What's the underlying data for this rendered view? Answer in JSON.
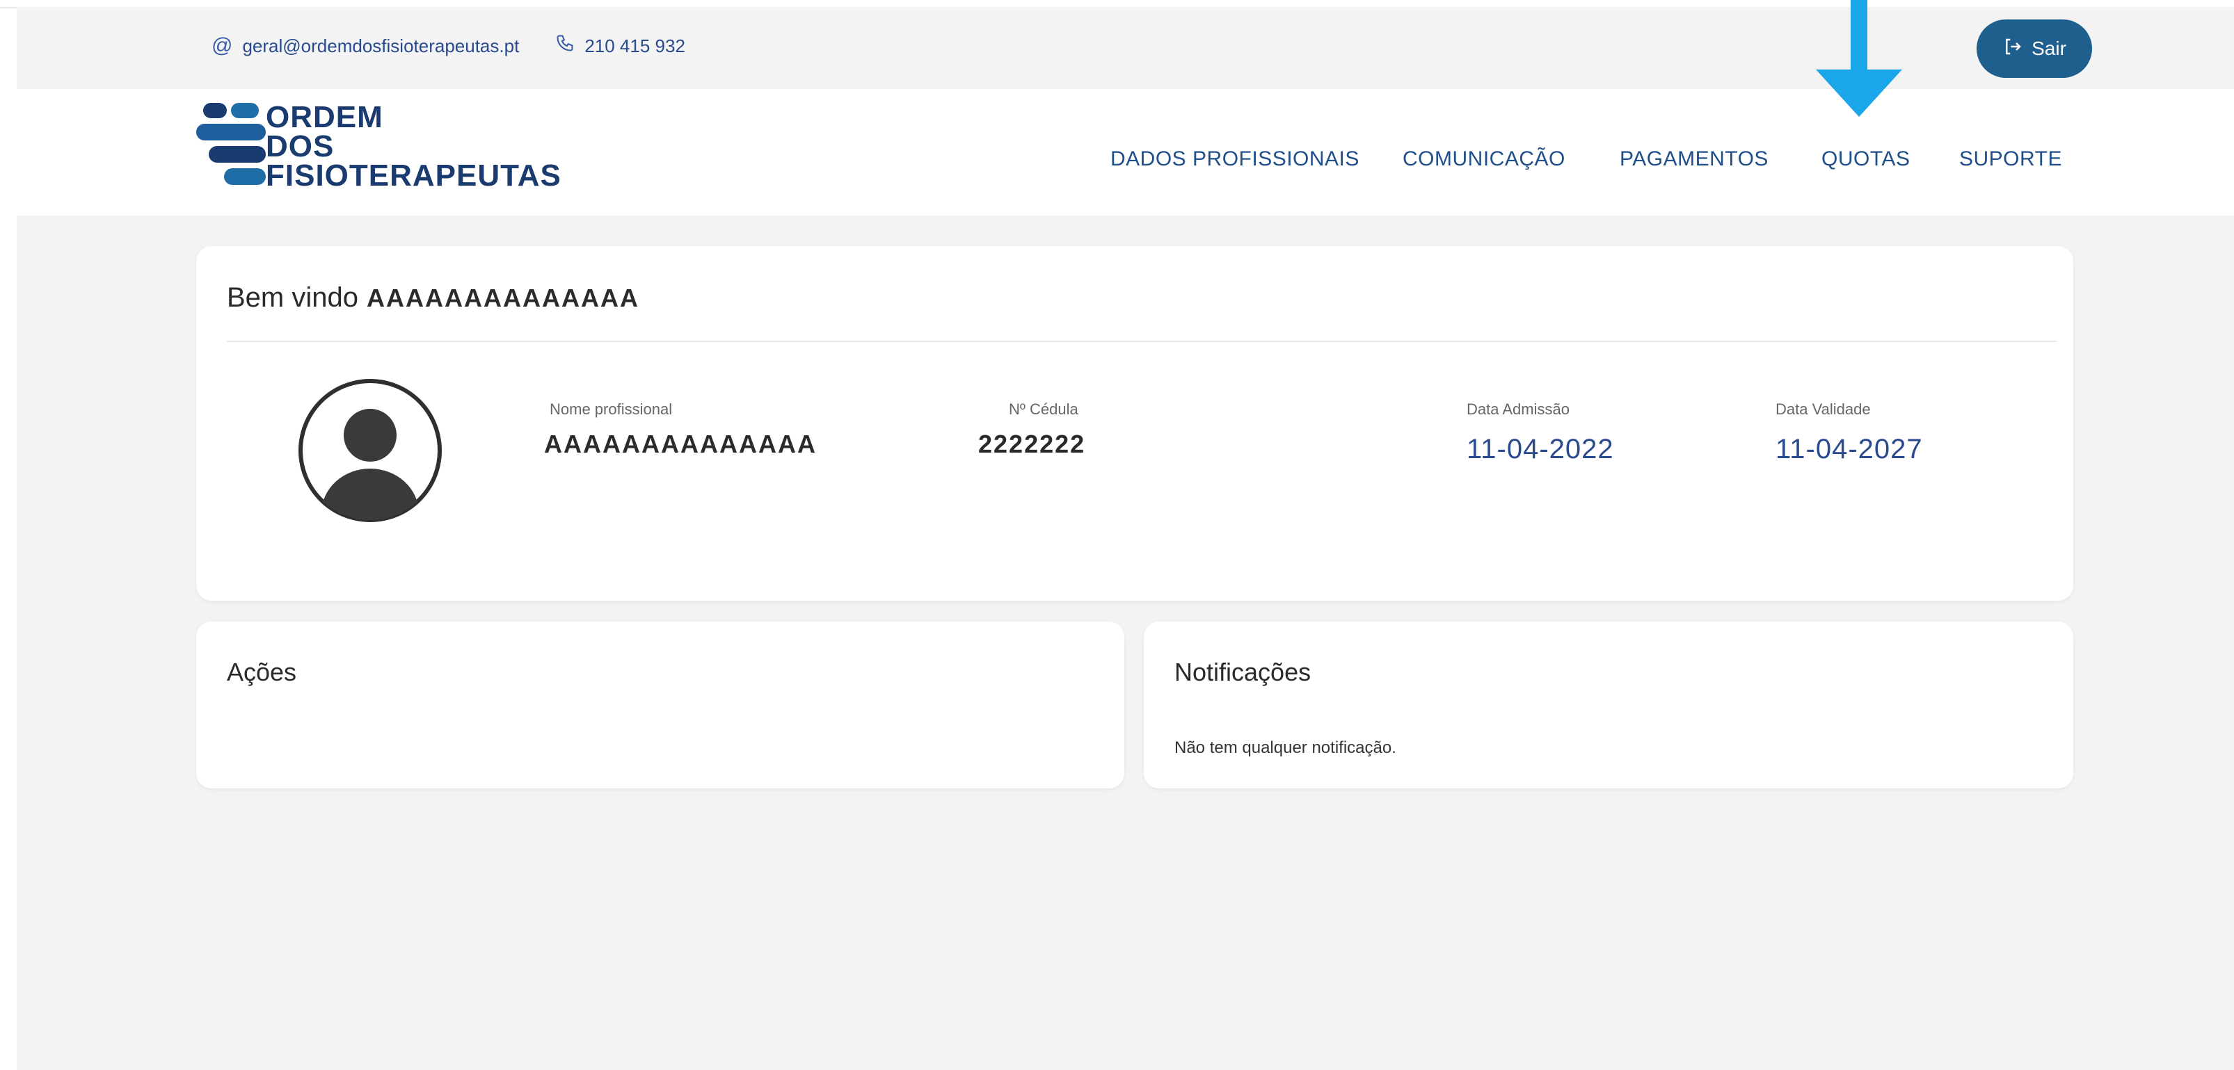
{
  "contact": {
    "email": "geral@ordemdosfisioterapeutas.pt",
    "phone": "210 415 932"
  },
  "logout": {
    "label": "Sair"
  },
  "logo": {
    "line1": "ORDEM",
    "line2": "DOS",
    "line3": "FISIOTERAPEUTAS"
  },
  "nav": {
    "items": [
      {
        "label": "DADOS PROFISSIONAIS"
      },
      {
        "label": "COMUNICAÇÃO"
      },
      {
        "label": "PAGAMENTOS"
      },
      {
        "label": "QUOTAS"
      },
      {
        "label": "SUPORTE"
      }
    ]
  },
  "welcome": {
    "greeting": "Bem vindo",
    "name": "AAAAAAAAAAAAAA",
    "fields": {
      "nome_label": "Nome profissional",
      "nome_value": "AAAAAAAAAAAAAA",
      "cedula_label": "Nº Cédula",
      "cedula_value": "2222222",
      "admissao_label": "Data Admissão",
      "admissao_value": "11-04-2022",
      "validade_label": "Data Validade",
      "validade_value": "11-04-2027"
    }
  },
  "acoes": {
    "title": "Ações"
  },
  "notificacoes": {
    "title": "Notificações",
    "empty_message": "Não tem qualquer notificação."
  },
  "colors": {
    "primary": "#1f5f8e",
    "nav_text": "#1f4f8a",
    "arrow": "#1aa6e8",
    "background": "#f3f3f3"
  }
}
